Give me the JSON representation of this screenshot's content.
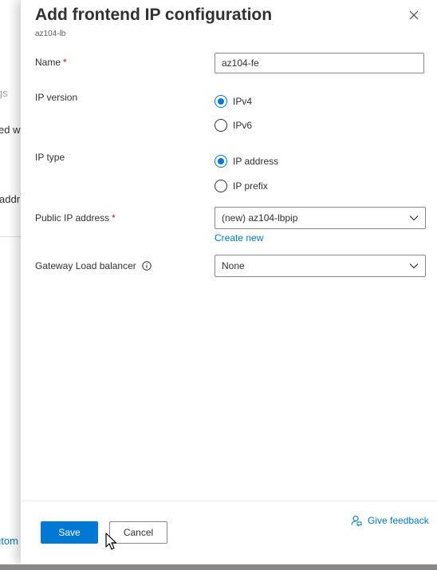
{
  "background": {
    "fragments": [
      "gs",
      "ed w",
      "addr",
      "utom"
    ]
  },
  "panel": {
    "title": "Add frontend IP configuration",
    "subtitle": "az104-lb"
  },
  "form": {
    "name": {
      "label": "Name",
      "required_mark": "*",
      "value": "az104-fe"
    },
    "ip_version": {
      "label": "IP version",
      "options": [
        "IPv4",
        "IPv6"
      ],
      "selected": "IPv4"
    },
    "ip_type": {
      "label": "IP type",
      "options": [
        "IP address",
        "IP prefix"
      ],
      "selected": "IP address"
    },
    "public_ip": {
      "label": "Public IP address",
      "required_mark": "*",
      "value": "(new) az104-lbpip",
      "create_new_label": "Create new"
    },
    "gateway_lb": {
      "label": "Gateway Load balancer",
      "value": "None"
    }
  },
  "footer": {
    "save_label": "Save",
    "cancel_label": "Cancel",
    "feedback_label": "Give feedback"
  },
  "colors": {
    "accent": "#0078d4",
    "required": "#a4262c",
    "text": "#323130"
  },
  "icons": [
    "close-icon",
    "info-icon",
    "chevron-down-icon",
    "feedback-icon",
    "mouse-cursor-icon"
  ]
}
